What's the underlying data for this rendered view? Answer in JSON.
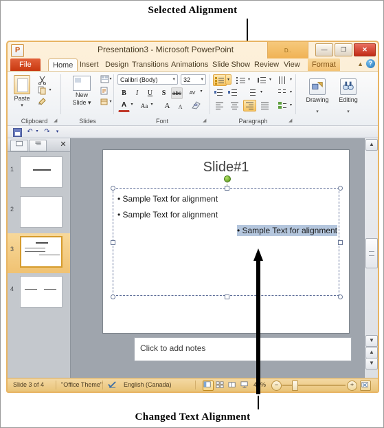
{
  "annotations": {
    "top": "Selected Alignment",
    "bottom": "Changed Text Alignment"
  },
  "window": {
    "app_logo": "P",
    "title": "Presentation3  -  Microsoft PowerPoint",
    "minimize": "—",
    "restore": "❐",
    "close": "✕",
    "context_tab_head": "D..",
    "ribbon_collapse_icon": "chevron-up-icon",
    "help_icon": "?"
  },
  "tabs": [
    {
      "label": "File",
      "state": "file"
    },
    {
      "label": "Home",
      "state": "active"
    },
    {
      "label": "Insert",
      "state": "normal"
    },
    {
      "label": "Design",
      "state": "normal"
    },
    {
      "label": "Transitions",
      "state": "normal"
    },
    {
      "label": "Animations",
      "state": "normal"
    },
    {
      "label": "Slide Show",
      "state": "normal"
    },
    {
      "label": "Review",
      "state": "normal"
    },
    {
      "label": "View",
      "state": "normal"
    },
    {
      "label": "Format",
      "state": "contextual"
    }
  ],
  "ribbon": {
    "groups": [
      {
        "name": "Clipboard",
        "label": "Clipboard"
      },
      {
        "name": "Slides",
        "label": "Slides"
      },
      {
        "name": "Font",
        "label": "Font"
      },
      {
        "name": "Paragraph",
        "label": "Paragraph"
      },
      {
        "name": "DrawingEditing",
        "label": ""
      }
    ],
    "clipboard": {
      "paste_label": "Paste",
      "paste_caret": "▾",
      "cut_icon": "scissors-icon",
      "copy_icon": "copy-icon",
      "format_painter_icon": "format-painter-icon",
      "dialog_launcher": "◢"
    },
    "slides": {
      "new_slide_label": "New",
      "new_slide_label2": "Slide ▾",
      "layout_icon": "layout-icon",
      "reset_icon": "reset-icon",
      "section_icon": "section-icon"
    },
    "font": {
      "font_name": "Calibri (Body)",
      "font_size": "32",
      "bold": "B",
      "italic": "I",
      "underline": "U",
      "shadow": "S",
      "strikethrough": "abc",
      "char_spacing": "AV",
      "font_color": "A",
      "change_case": "Aa",
      "grow_font": "A",
      "shrink_font": "A",
      "clear_formatting_icon": "clear-formatting-icon",
      "dialog_launcher": "◢"
    },
    "paragraph": {
      "bullets_icon": "bullets-icon",
      "numbering_icon": "numbering-icon",
      "decrease_indent_icon": "decrease-indent-icon",
      "increase_indent_icon": "increase-indent-icon",
      "line_spacing_icon": "line-spacing-icon",
      "text_direction_icon": "text-direction-icon",
      "align_text_icon": "align-text-icon",
      "columns_icon": "columns-icon",
      "convert_smartart_icon": "convert-to-smartart-icon",
      "align_left": "align-left-icon",
      "align_center": "align-center-icon",
      "align_right": "align-right-icon",
      "justify": "justify-icon",
      "selected_alignment": "align-right-icon",
      "dialog_launcher": "◢"
    },
    "drawing": {
      "label": "Drawing",
      "caret": "▾",
      "icon": "shapes-icon"
    },
    "editing": {
      "label": "Editing",
      "caret": "▾",
      "icon": "binoculars-icon"
    }
  },
  "quick_access": {
    "save_icon": "save-icon",
    "undo_icon": "↶",
    "undo_caret": "▾",
    "redo_icon": "↷",
    "customize_caret": "▾"
  },
  "slide_pane": {
    "tab_slides_icon": "slides-tab-icon",
    "tab_outline_icon": "outline-tab-icon",
    "close_icon": "✕",
    "thumbnails": [
      {
        "number": "1",
        "selected": false,
        "kind": "title"
      },
      {
        "number": "2",
        "selected": false,
        "kind": "blank"
      },
      {
        "number": "3",
        "selected": true,
        "kind": "content"
      },
      {
        "number": "4",
        "selected": false,
        "kind": "two-content"
      }
    ]
  },
  "slide": {
    "title": "Slide#1",
    "lines": [
      {
        "text": "Sample Text for alignment",
        "align": "left",
        "bullet": true,
        "highlighted": false
      },
      {
        "text": "Sample Text for alignment",
        "align": "left",
        "bullet": true,
        "highlighted": false
      },
      {
        "text": "Sample Text for alignment",
        "align": "right",
        "bullet": true,
        "highlighted": true
      }
    ]
  },
  "notes": {
    "placeholder": "Click to add notes"
  },
  "scrollbar": {
    "up_arrow": "▲",
    "down_arrow": "▼",
    "prev_slide": "▲",
    "next_slide": "▼"
  },
  "status_bar": {
    "slide_counter": "Slide 3 of 4",
    "theme": "\"Office Theme\"",
    "spellcheck_icon": "spellcheck-icon",
    "language": "English (Canada)",
    "views": [
      {
        "name": "normal-view",
        "selected": true
      },
      {
        "name": "slide-sorter-view",
        "selected": false
      },
      {
        "name": "reading-view",
        "selected": false
      },
      {
        "name": "slide-show-view",
        "selected": false
      }
    ],
    "zoom_level": "41%",
    "zoom_out": "−",
    "zoom_in": "+",
    "fit_to_window_icon": "fit-to-window-icon"
  }
}
